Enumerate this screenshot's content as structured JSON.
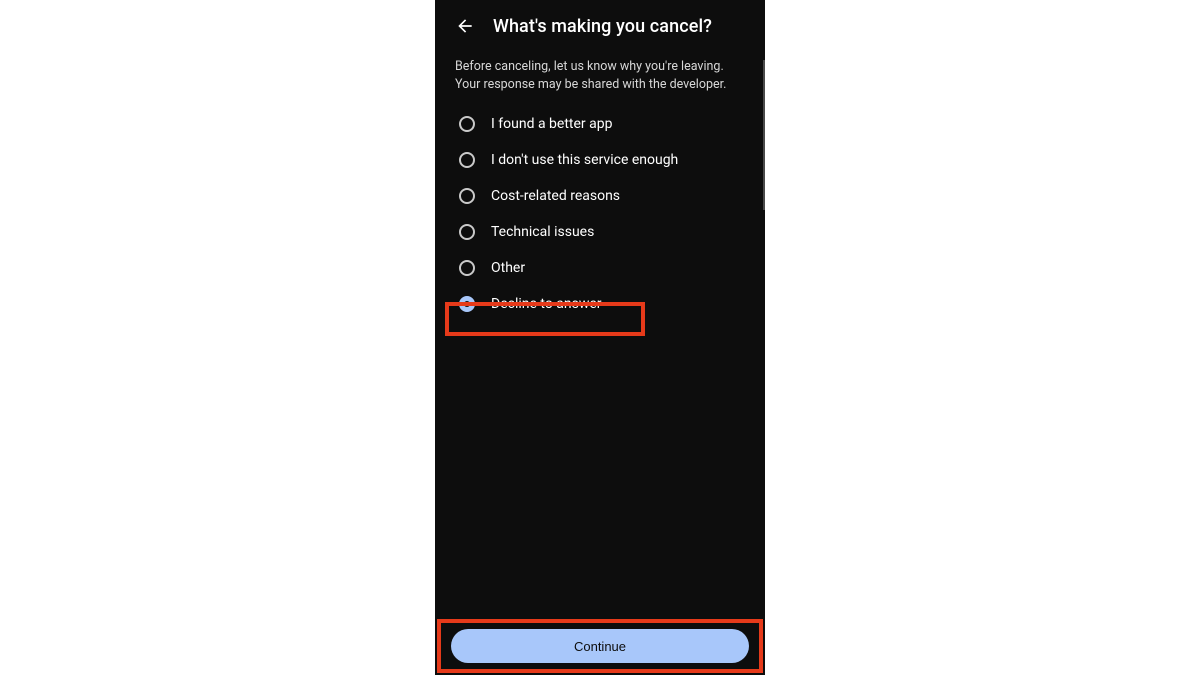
{
  "header": {
    "title": "What's making you cancel?"
  },
  "description": "Before canceling, let us know why you're leaving. Your response may be shared with the developer.",
  "options": [
    {
      "label": "I found a better app",
      "selected": false
    },
    {
      "label": "I don't use this service enough",
      "selected": false
    },
    {
      "label": "Cost-related reasons",
      "selected": false
    },
    {
      "label": "Technical issues",
      "selected": false
    },
    {
      "label": "Other",
      "selected": false
    },
    {
      "label": "Decline to answer",
      "selected": true
    }
  ],
  "footer": {
    "continue_label": "Continue"
  },
  "colors": {
    "accent": "#a8c7fa",
    "highlight": "#e63a1a",
    "background": "#0d0d0d"
  }
}
